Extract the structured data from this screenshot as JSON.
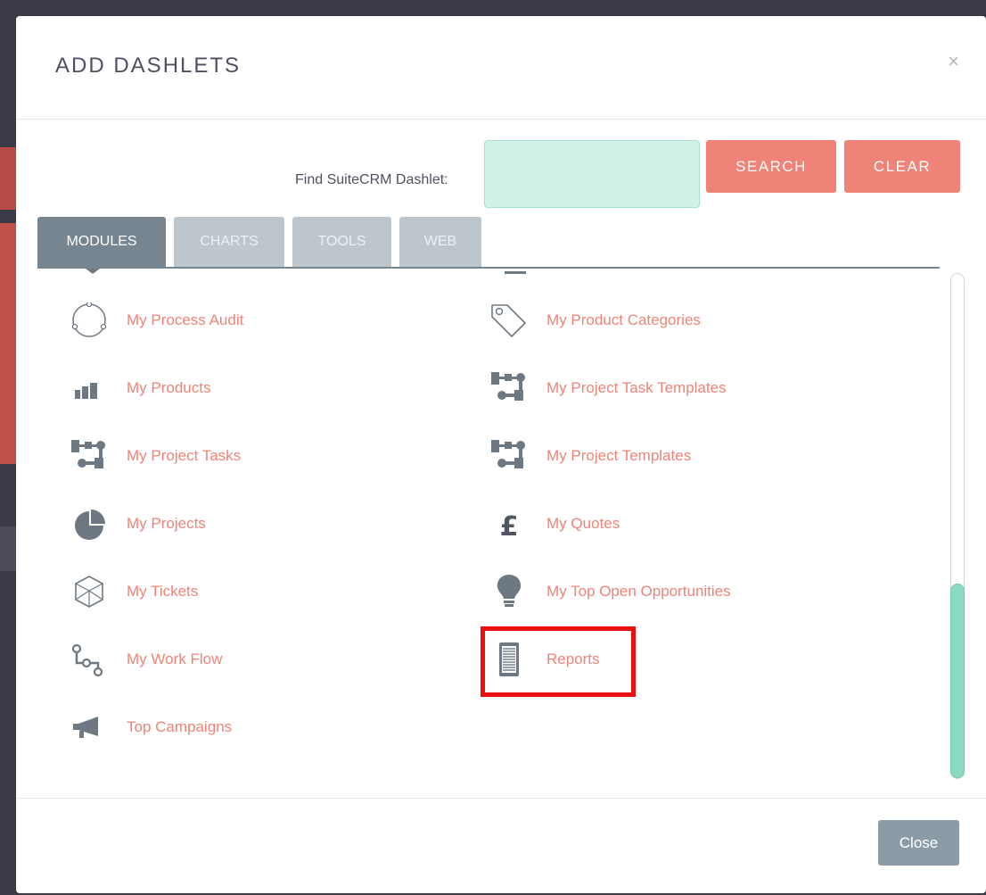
{
  "modal": {
    "title": "ADD DASHLETS",
    "close_symbol": "×",
    "find_label": "Find SuiteCRM Dashlet:",
    "search_value": "",
    "search_button": "SEARCH",
    "clear_button": "CLEAR",
    "close_button": "Close"
  },
  "tabs": [
    {
      "label": "MODULES",
      "active": true
    },
    {
      "label": "CHARTS",
      "active": false
    },
    {
      "label": "TOOLS",
      "active": false
    },
    {
      "label": "WEB",
      "active": false
    }
  ],
  "dashlets_left": [
    {
      "label": "My Process Audit",
      "icon": "process-audit-icon"
    },
    {
      "label": "My Products",
      "icon": "products-icon"
    },
    {
      "label": "My Project Tasks",
      "icon": "project-tasks-icon"
    },
    {
      "label": "My Projects",
      "icon": "projects-icon"
    },
    {
      "label": "My Tickets",
      "icon": "tickets-icon"
    },
    {
      "label": "My Work Flow",
      "icon": "workflow-icon"
    },
    {
      "label": "Top Campaigns",
      "icon": "campaigns-icon"
    }
  ],
  "dashlets_right": [
    {
      "label": "My Product Categories",
      "icon": "product-categories-icon"
    },
    {
      "label": "My Project Task Templates",
      "icon": "project-task-templates-icon"
    },
    {
      "label": "My Project Templates",
      "icon": "project-templates-icon"
    },
    {
      "label": "My Quotes",
      "icon": "quotes-icon"
    },
    {
      "label": "My Top Open Opportunities",
      "icon": "opportunities-icon"
    },
    {
      "label": "Reports",
      "icon": "reports-icon"
    }
  ],
  "colors": {
    "accent": "#f08377",
    "tab_active": "#778591",
    "tab_inactive": "#bcc6cc",
    "highlight": "#ea0f11",
    "search_bg": "#d0f2e8",
    "scroll_thumb": "#8ddac4"
  },
  "scroll_position": 0.9
}
